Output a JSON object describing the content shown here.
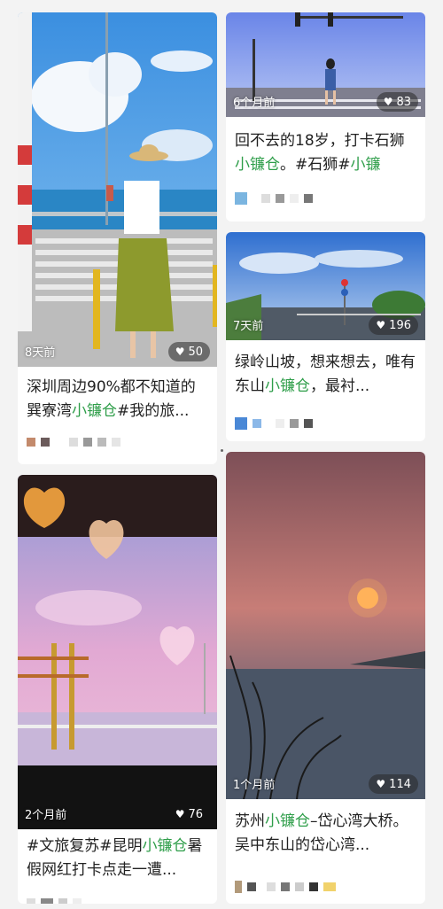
{
  "cards": [
    {
      "time": "8天前",
      "likes": "50",
      "title": [
        {
          "t": "深圳周边90%都不知道的巽寮湾"
        },
        {
          "t": "小镰仓",
          "kw": true
        },
        {
          "t": "#我的旅..."
        }
      ]
    },
    {
      "time": "6个月前",
      "likes": "83",
      "title": [
        {
          "t": "回不去的18岁，打卡石狮"
        },
        {
          "t": "小镰仓",
          "kw": true
        },
        {
          "t": "。#石狮#"
        },
        {
          "t": "小镰",
          "kw": true
        }
      ]
    },
    {
      "time": "7天前",
      "likes": "196",
      "title": [
        {
          "t": "绿岭山坡，想来想去，唯有东山"
        },
        {
          "t": "小镰仓",
          "kw": true
        },
        {
          "t": "，最衬..."
        }
      ]
    },
    {
      "time": "2个月前",
      "likes": "76",
      "title": [
        {
          "t": "#文旅复苏#昆明"
        },
        {
          "t": "小镰仓",
          "kw": true
        },
        {
          "t": "暑假网红打卡点走一遭..."
        }
      ]
    },
    {
      "time": "1个月前",
      "likes": "114",
      "title": [
        {
          "t": "苏州"
        },
        {
          "t": "小镰仓",
          "kw": true
        },
        {
          "t": "–岱心湾大桥。吴中东山的岱心湾..."
        }
      ]
    }
  ],
  "colors": {
    "keyword": "#2f9e4a",
    "text": "#222222"
  },
  "icons": {
    "likes": "heart-icon"
  }
}
